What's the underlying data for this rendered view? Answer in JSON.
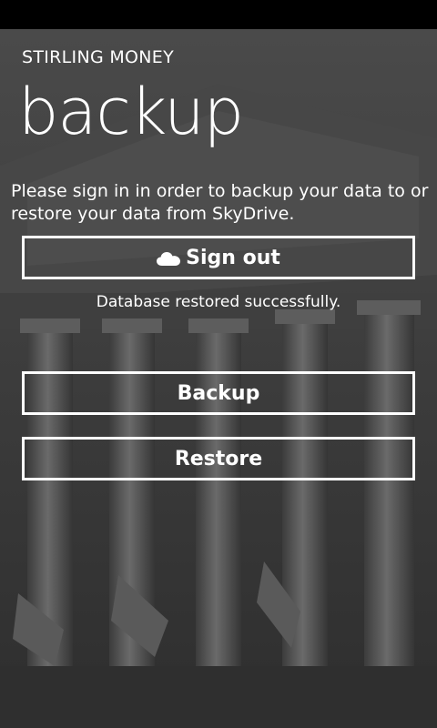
{
  "app": {
    "name": "STIRLING MONEY"
  },
  "page": {
    "title": "backup",
    "instructions": "Please sign in in order to backup your data to or restore your data from SkyDrive."
  },
  "buttons": {
    "sign_out": {
      "label": "Sign out",
      "icon": "cloud-icon"
    },
    "backup": {
      "label": "Backup"
    },
    "restore": {
      "label": "Restore"
    }
  },
  "status": {
    "message": "Database restored successfully."
  },
  "colors": {
    "foreground": "#ffffff",
    "status_bar": "#000000",
    "background": "#3a3a3a"
  }
}
